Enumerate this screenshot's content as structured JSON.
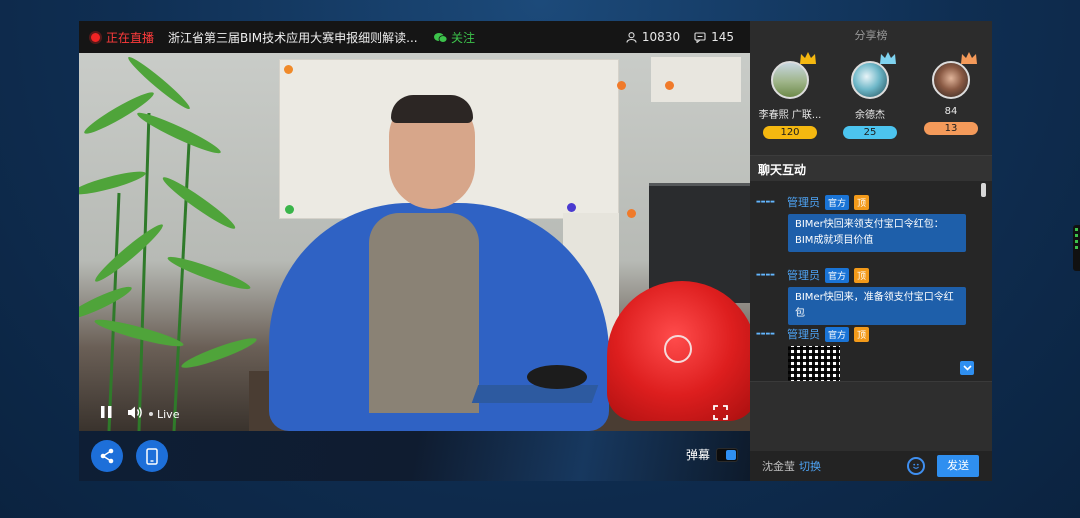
{
  "player": {
    "live_status": "正在直播",
    "title": "浙江省第三届BIM技术应用大赛申报细则解读...",
    "follow_label": "关注",
    "viewers": "10830",
    "comments": "145",
    "live_tag": "Live",
    "danmu_label": "弹幕"
  },
  "share_board": {
    "title": "分享榜",
    "rankers": [
      {
        "name": "李春熙 广联...",
        "score": "120",
        "color": "#f5b810"
      },
      {
        "name": "余德杰",
        "score": "25",
        "color": "#4cc4ef"
      },
      {
        "name": "84",
        "score": "13",
        "color": "#f49a5a"
      }
    ]
  },
  "chat": {
    "header": "聊天互动",
    "messages": [
      {
        "user": "管理员",
        "official": "官方",
        "top": "顶",
        "text": "BIMer快回来领支付宝口令红包：BIM成就项目价值"
      },
      {
        "user": "管理员",
        "official": "官方",
        "top": "顶",
        "text": "BIMer快回来，准备领支付宝口令红包"
      },
      {
        "user": "管理员",
        "official": "官方",
        "top": "顶",
        "text": ""
      }
    ]
  },
  "footer": {
    "username": "沈金莹",
    "switch_label": "切换",
    "send_label": "发送"
  }
}
